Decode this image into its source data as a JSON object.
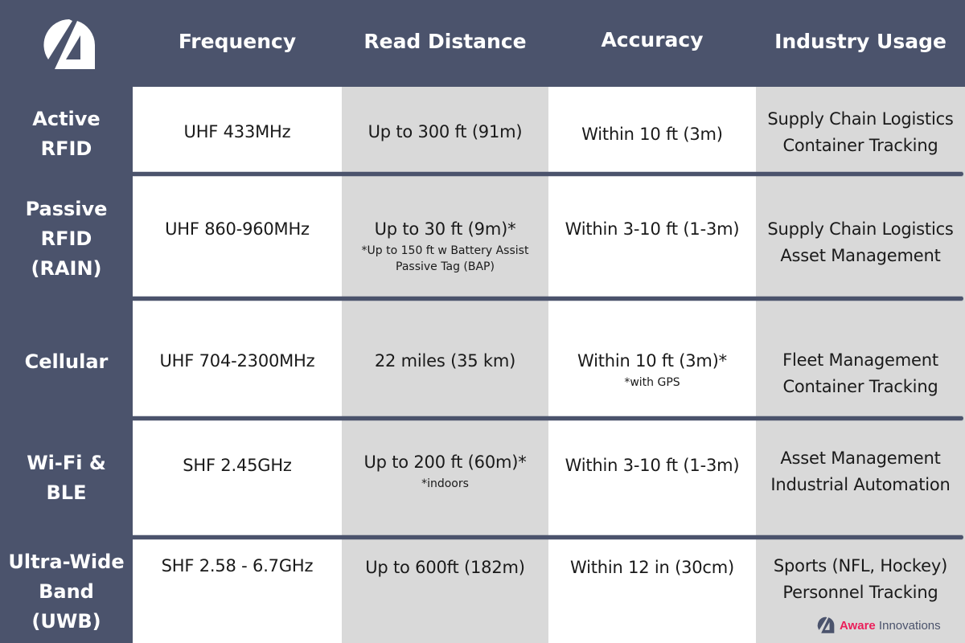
{
  "brand": {
    "name_part1": "Aware",
    "name_part2": " Innovations",
    "logo_icon": "aware-innovations-logo-icon",
    "colors": {
      "navy": "#4b536c",
      "accent": "#ea1f5a",
      "gray": "#d9d9d9",
      "white": "#ffffff"
    }
  },
  "columns": [
    "Frequency",
    "Read Distance",
    "Accuracy",
    "Industry Usage"
  ],
  "rows": [
    {
      "label": [
        "Active",
        "RFID"
      ],
      "frequency": {
        "main": "UHF 433MHz"
      },
      "read_distance": {
        "main": "Up to 300 ft (91m)"
      },
      "accuracy": {
        "main": "Within 10 ft (3m)"
      },
      "industry_usage": {
        "lines": [
          "Supply Chain Logistics",
          "Container Tracking"
        ]
      }
    },
    {
      "label": [
        "Passive",
        "RFID",
        "(RAIN)"
      ],
      "frequency": {
        "main": "UHF 860-960MHz"
      },
      "read_distance": {
        "main": "Up to 30 ft (9m)*",
        "note": [
          "*Up to 150 ft w Battery Assist",
          "Passive Tag (BAP)"
        ]
      },
      "accuracy": {
        "main": "Within 3-10 ft (1-3m)"
      },
      "industry_usage": {
        "lines": [
          "Supply Chain Logistics",
          "Asset Management"
        ]
      }
    },
    {
      "label": [
        "Cellular"
      ],
      "frequency": {
        "main": "UHF 704-2300MHz"
      },
      "read_distance": {
        "main": "22 miles (35 km)"
      },
      "accuracy": {
        "main": "Within 10 ft (3m)*",
        "note": [
          "*with GPS"
        ]
      },
      "industry_usage": {
        "lines": [
          "Fleet Management",
          "Container Tracking"
        ]
      }
    },
    {
      "label": [
        "Wi-Fi &",
        "BLE"
      ],
      "frequency": {
        "main": "SHF 2.45GHz"
      },
      "read_distance": {
        "main": "Up to 200 ft (60m)*",
        "note": [
          "*indoors"
        ]
      },
      "accuracy": {
        "main": "Within 3-10 ft (1-3m)"
      },
      "industry_usage": {
        "lines": [
          "Asset Management",
          "Industrial Automation"
        ]
      }
    },
    {
      "label": [
        "Ultra-Wide",
        "Band",
        "(UWB)"
      ],
      "frequency": {
        "main": "SHF 2.58 - 6.7GHz"
      },
      "read_distance": {
        "main": "Up to 600ft (182m)"
      },
      "accuracy": {
        "main": "Within 12 in (30cm)"
      },
      "industry_usage": {
        "lines": [
          "Sports (NFL, Hockey)",
          "Personnel Tracking"
        ]
      }
    }
  ]
}
